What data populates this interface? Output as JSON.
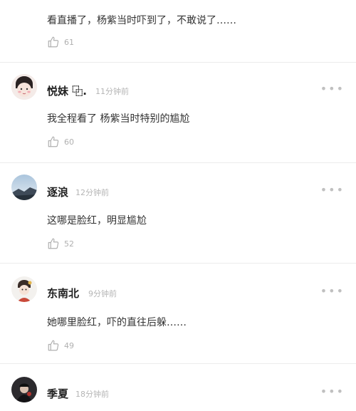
{
  "comments": [
    {
      "name": "",
      "time": "",
      "text": "看直播了，杨紫当时吓到了，不敢说了……",
      "likes": "61"
    },
    {
      "name": "悦妹 ⿻.",
      "time": "11分钟前",
      "text": "我全程看了 杨紫当时特别的尴尬",
      "likes": "60"
    },
    {
      "name": "逐浪",
      "time": "12分钟前",
      "text": "这哪是脸红，明显尴尬",
      "likes": "52"
    },
    {
      "name": "东南北",
      "time": "9分钟前",
      "text": "她哪里脸红，吓的直往后躲……",
      "likes": "49"
    },
    {
      "name": "季夏",
      "time": "18分钟前",
      "text": "",
      "likes": ""
    }
  ],
  "icons": {
    "like": "thumbs-up-icon",
    "more": "more-dots-icon"
  },
  "colors": {
    "name": "#222222",
    "meta": "#b5b5b5",
    "text": "#333333",
    "divider": "#ececec"
  }
}
